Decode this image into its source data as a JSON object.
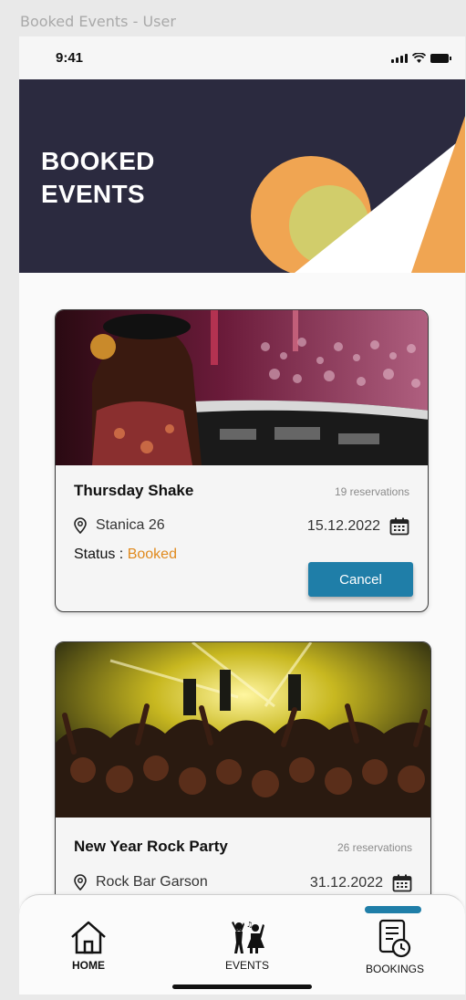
{
  "frame_label": "Booked Events - User",
  "status_bar": {
    "time": "9:41",
    "icons": [
      "signal-icon",
      "wifi-icon",
      "battery-icon"
    ]
  },
  "header": {
    "title": "BOOKED\nEVENTS",
    "colors": {
      "background": "#2b2a3f",
      "orange": "#f0a552",
      "lime": "#d1cd6b",
      "white": "#ffffff"
    }
  },
  "events": [
    {
      "title": "Thursday Shake",
      "reservations": "19 reservations",
      "location": "Stanica 26",
      "date": "15.12.2022",
      "status_label": "Status :",
      "status_value": "Booked",
      "cancel_label": "Cancel"
    },
    {
      "title": "New Year Rock Party",
      "reservations": "26 reservations",
      "location": "Rock Bar Garson",
      "date": "31.12.2022"
    }
  ],
  "tabbar": {
    "items": [
      {
        "label": "HOME",
        "icon": "home-icon"
      },
      {
        "label": "EVENTS",
        "icon": "dancing-people-icon"
      },
      {
        "label": "BOOKINGS",
        "icon": "bookings-clock-icon"
      }
    ],
    "active": "BOOKINGS",
    "accent": "#1f7ea8"
  },
  "status_color": "#e08a1e"
}
